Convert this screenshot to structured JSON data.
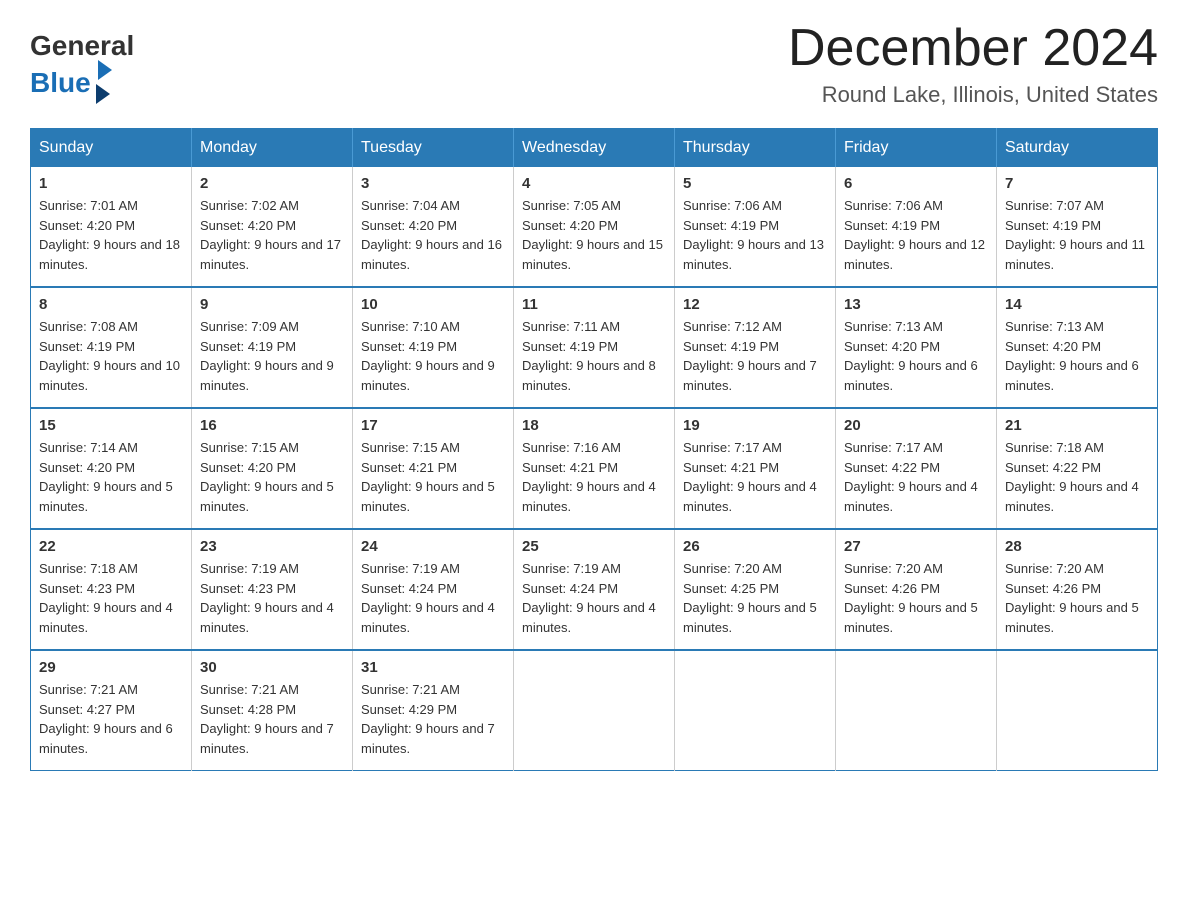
{
  "logo": {
    "text_general": "General",
    "text_blue": "Blue"
  },
  "title": {
    "month": "December 2024",
    "location": "Round Lake, Illinois, United States"
  },
  "calendar": {
    "headers": [
      "Sunday",
      "Monday",
      "Tuesday",
      "Wednesday",
      "Thursday",
      "Friday",
      "Saturday"
    ],
    "weeks": [
      [
        {
          "day": "1",
          "sunrise": "7:01 AM",
          "sunset": "4:20 PM",
          "daylight": "9 hours and 18 minutes."
        },
        {
          "day": "2",
          "sunrise": "7:02 AM",
          "sunset": "4:20 PM",
          "daylight": "9 hours and 17 minutes."
        },
        {
          "day": "3",
          "sunrise": "7:04 AM",
          "sunset": "4:20 PM",
          "daylight": "9 hours and 16 minutes."
        },
        {
          "day": "4",
          "sunrise": "7:05 AM",
          "sunset": "4:20 PM",
          "daylight": "9 hours and 15 minutes."
        },
        {
          "day": "5",
          "sunrise": "7:06 AM",
          "sunset": "4:19 PM",
          "daylight": "9 hours and 13 minutes."
        },
        {
          "day": "6",
          "sunrise": "7:06 AM",
          "sunset": "4:19 PM",
          "daylight": "9 hours and 12 minutes."
        },
        {
          "day": "7",
          "sunrise": "7:07 AM",
          "sunset": "4:19 PM",
          "daylight": "9 hours and 11 minutes."
        }
      ],
      [
        {
          "day": "8",
          "sunrise": "7:08 AM",
          "sunset": "4:19 PM",
          "daylight": "9 hours and 10 minutes."
        },
        {
          "day": "9",
          "sunrise": "7:09 AM",
          "sunset": "4:19 PM",
          "daylight": "9 hours and 9 minutes."
        },
        {
          "day": "10",
          "sunrise": "7:10 AM",
          "sunset": "4:19 PM",
          "daylight": "9 hours and 9 minutes."
        },
        {
          "day": "11",
          "sunrise": "7:11 AM",
          "sunset": "4:19 PM",
          "daylight": "9 hours and 8 minutes."
        },
        {
          "day": "12",
          "sunrise": "7:12 AM",
          "sunset": "4:19 PM",
          "daylight": "9 hours and 7 minutes."
        },
        {
          "day": "13",
          "sunrise": "7:13 AM",
          "sunset": "4:20 PM",
          "daylight": "9 hours and 6 minutes."
        },
        {
          "day": "14",
          "sunrise": "7:13 AM",
          "sunset": "4:20 PM",
          "daylight": "9 hours and 6 minutes."
        }
      ],
      [
        {
          "day": "15",
          "sunrise": "7:14 AM",
          "sunset": "4:20 PM",
          "daylight": "9 hours and 5 minutes."
        },
        {
          "day": "16",
          "sunrise": "7:15 AM",
          "sunset": "4:20 PM",
          "daylight": "9 hours and 5 minutes."
        },
        {
          "day": "17",
          "sunrise": "7:15 AM",
          "sunset": "4:21 PM",
          "daylight": "9 hours and 5 minutes."
        },
        {
          "day": "18",
          "sunrise": "7:16 AM",
          "sunset": "4:21 PM",
          "daylight": "9 hours and 4 minutes."
        },
        {
          "day": "19",
          "sunrise": "7:17 AM",
          "sunset": "4:21 PM",
          "daylight": "9 hours and 4 minutes."
        },
        {
          "day": "20",
          "sunrise": "7:17 AM",
          "sunset": "4:22 PM",
          "daylight": "9 hours and 4 minutes."
        },
        {
          "day": "21",
          "sunrise": "7:18 AM",
          "sunset": "4:22 PM",
          "daylight": "9 hours and 4 minutes."
        }
      ],
      [
        {
          "day": "22",
          "sunrise": "7:18 AM",
          "sunset": "4:23 PM",
          "daylight": "9 hours and 4 minutes."
        },
        {
          "day": "23",
          "sunrise": "7:19 AM",
          "sunset": "4:23 PM",
          "daylight": "9 hours and 4 minutes."
        },
        {
          "day": "24",
          "sunrise": "7:19 AM",
          "sunset": "4:24 PM",
          "daylight": "9 hours and 4 minutes."
        },
        {
          "day": "25",
          "sunrise": "7:19 AM",
          "sunset": "4:24 PM",
          "daylight": "9 hours and 4 minutes."
        },
        {
          "day": "26",
          "sunrise": "7:20 AM",
          "sunset": "4:25 PM",
          "daylight": "9 hours and 5 minutes."
        },
        {
          "day": "27",
          "sunrise": "7:20 AM",
          "sunset": "4:26 PM",
          "daylight": "9 hours and 5 minutes."
        },
        {
          "day": "28",
          "sunrise": "7:20 AM",
          "sunset": "4:26 PM",
          "daylight": "9 hours and 5 minutes."
        }
      ],
      [
        {
          "day": "29",
          "sunrise": "7:21 AM",
          "sunset": "4:27 PM",
          "daylight": "9 hours and 6 minutes."
        },
        {
          "day": "30",
          "sunrise": "7:21 AM",
          "sunset": "4:28 PM",
          "daylight": "9 hours and 7 minutes."
        },
        {
          "day": "31",
          "sunrise": "7:21 AM",
          "sunset": "4:29 PM",
          "daylight": "9 hours and 7 minutes."
        },
        null,
        null,
        null,
        null
      ]
    ]
  }
}
